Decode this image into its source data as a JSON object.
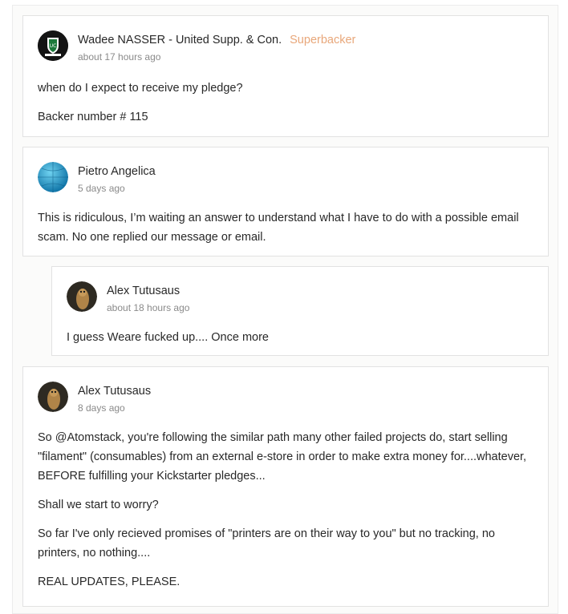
{
  "comments": [
    {
      "author": "Wadee NASSER - United Supp. & Con.",
      "badge": "Superbacker",
      "time": "about 17 hours ago",
      "avatar_icon": "shield-crest-logo-avatar",
      "paragraphs": [
        "when do I expect to receive my pledge?",
        "Backer number # 115"
      ]
    },
    {
      "author": "Pietro Angelica",
      "time": "5 days ago",
      "avatar_icon": "blue-globe-avatar",
      "paragraphs": [
        "This is ridiculous, I’m waiting an answer to understand what I have to do with a possible email scam. No one replied our message or email."
      ]
    },
    {
      "author": "Alex Tutusaus",
      "time": "about 18 hours ago",
      "avatar_icon": "owl-photo-avatar",
      "reply": true,
      "paragraphs": [
        "I guess Weare fucked up.... Once more"
      ]
    },
    {
      "author": "Alex Tutusaus",
      "time": "8 days ago",
      "avatar_icon": "owl-photo-avatar",
      "paragraphs": [
        "So @Atomstack, you're following the similar path many other failed projects do, start selling \"filament\" (consumables) from an external e-store in order to make extra money for....whatever, BEFORE fulfilling your Kickstarter pledges...",
        "Shall we start to worry?",
        "So far I've only recieved promises of \"printers are on their way to you\" but no tracking, no printers, no nothing....",
        "REAL UPDATES, PLEASE."
      ]
    }
  ],
  "colors": {
    "badge": "#e8a77a",
    "time": "#8a8a8a",
    "text": "#282828",
    "border": "#e2e2e2"
  }
}
